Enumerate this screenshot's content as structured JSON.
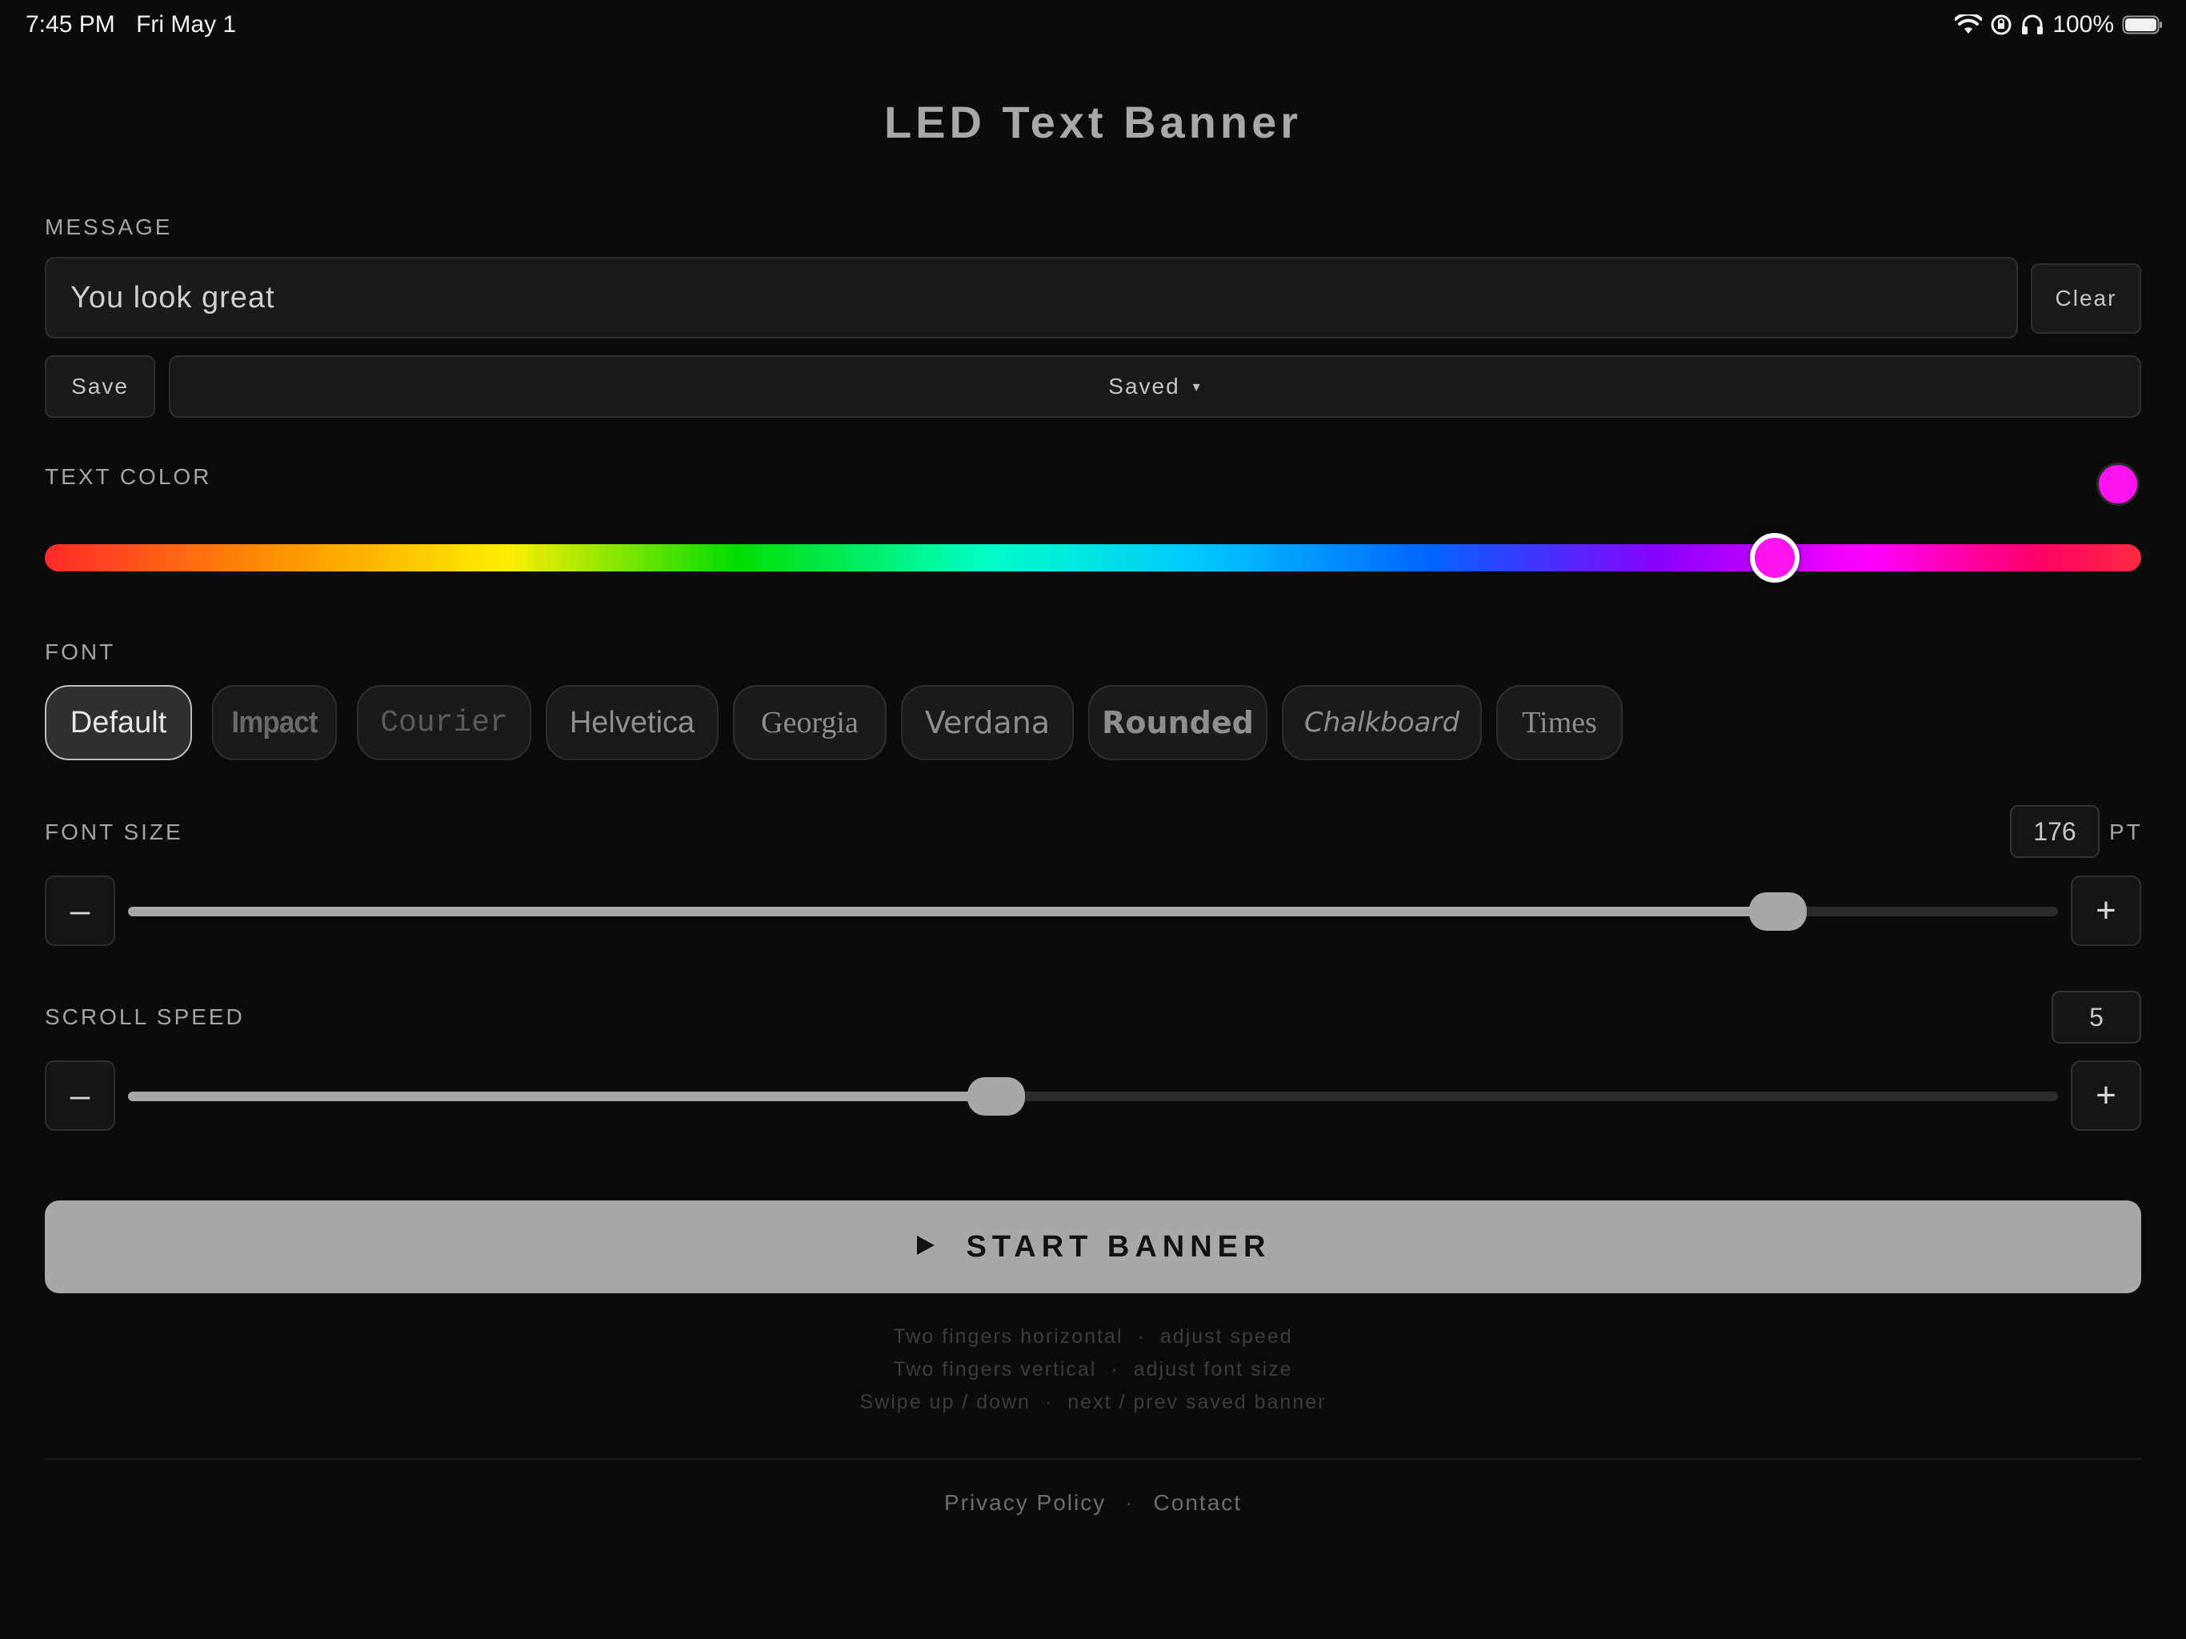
{
  "status_bar": {
    "time": "7:45 PM",
    "date": "Fri May 1",
    "battery": "100%",
    "icons": [
      "wifi-icon",
      "orientation-lock-icon",
      "headphones-icon",
      "battery-icon"
    ]
  },
  "title": "LED Text Banner",
  "message": {
    "label": "MESSAGE",
    "value": "You look great",
    "clear_label": "Clear",
    "save_label": "Save",
    "saved_select": "Saved",
    "saved_select_caret": "▾"
  },
  "text_color": {
    "label": "TEXT COLOR",
    "hue_fraction": 0.825,
    "current_color": "#ff14f0"
  },
  "font": {
    "label": "FONT",
    "selected": "Default",
    "options": [
      "Default",
      "Impact",
      "Courier",
      "Helvetica",
      "Georgia",
      "Verdana",
      "Rounded",
      "Chalkboard",
      "Times"
    ]
  },
  "font_size": {
    "label": "FONT SIZE",
    "value": "176",
    "unit": "PT",
    "fraction": 0.855,
    "minus": "–",
    "plus": "+"
  },
  "scroll_speed": {
    "label": "SCROLL SPEED",
    "value": "5",
    "fraction": 0.45,
    "minus": "–",
    "plus": "+"
  },
  "start_button": {
    "label": "START BANNER",
    "icon": "play-icon"
  },
  "hints": [
    {
      "gesture": "Two fingers horizontal",
      "sep": "·",
      "action": "adjust speed"
    },
    {
      "gesture": "Two fingers vertical",
      "sep": "·",
      "action": "adjust font size"
    },
    {
      "gesture": "Swipe up / down",
      "sep": "·",
      "action": "next / prev saved banner"
    }
  ],
  "footer": {
    "privacy": "Privacy Policy",
    "sep": "·",
    "contact": "Contact"
  },
  "colors": {
    "background": "#0b0b0b",
    "accent": "#a8a8a8"
  }
}
